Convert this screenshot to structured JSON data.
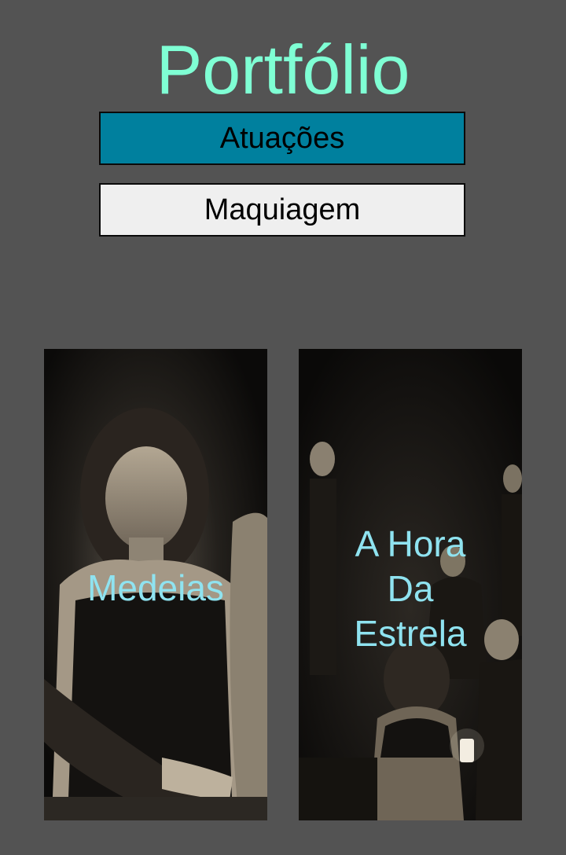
{
  "header": {
    "title": "Portfólio"
  },
  "tabs": [
    {
      "label": "Atuações",
      "active": true,
      "color": "#00809e"
    },
    {
      "label": "Maquiagem",
      "active": false,
      "color": "#efefef"
    }
  ],
  "projects": [
    {
      "title": "Medeias"
    },
    {
      "title": "A Hora\nDa\nEstrela"
    }
  ],
  "colors": {
    "background": "#535353",
    "title": "#7fffd4",
    "card_label": "#8fe3f0"
  }
}
